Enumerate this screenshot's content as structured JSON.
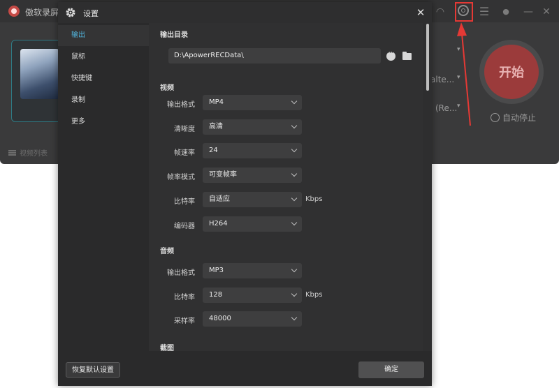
{
  "background_app": {
    "title": "傲软录屏",
    "start_label": "开始",
    "autostop_label": "自动停止",
    "video_list_label": "视频列表",
    "dropdown_fragment_1": "alte...",
    "dropdown_fragment_2": "(Re...",
    "highlight_color": "#e53935",
    "start_color": "#9b3b3b"
  },
  "dialog": {
    "title": "设置",
    "close_glyph": "✕",
    "nav": [
      {
        "label": "输出",
        "active": true
      },
      {
        "label": "鼠标"
      },
      {
        "label": "快捷键"
      },
      {
        "label": "录制"
      },
      {
        "label": "更多"
      }
    ],
    "output_dir": {
      "section_title": "输出目录",
      "path": "D:\\ApowerRECData\\"
    },
    "video": {
      "section_title": "视频",
      "rows": [
        {
          "label": "输出格式",
          "value": "MP4"
        },
        {
          "label": "清晰度",
          "value": "高清"
        },
        {
          "label": "帧速率",
          "value": "24"
        },
        {
          "label": "帧率模式",
          "value": "可变帧率"
        },
        {
          "label": "比特率",
          "value": "自适应",
          "unit": "Kbps"
        },
        {
          "label": "编码器",
          "value": "H264"
        }
      ]
    },
    "audio": {
      "section_title": "音频",
      "rows": [
        {
          "label": "输出格式",
          "value": "MP3"
        },
        {
          "label": "比特率",
          "value": "128",
          "unit": "Kbps"
        },
        {
          "label": "采样率",
          "value": "48000"
        }
      ]
    },
    "screenshot": {
      "section_title": "截图"
    },
    "reset_label": "恢复默认设置",
    "ok_label": "确定",
    "accent_color": "#52b7e0"
  }
}
